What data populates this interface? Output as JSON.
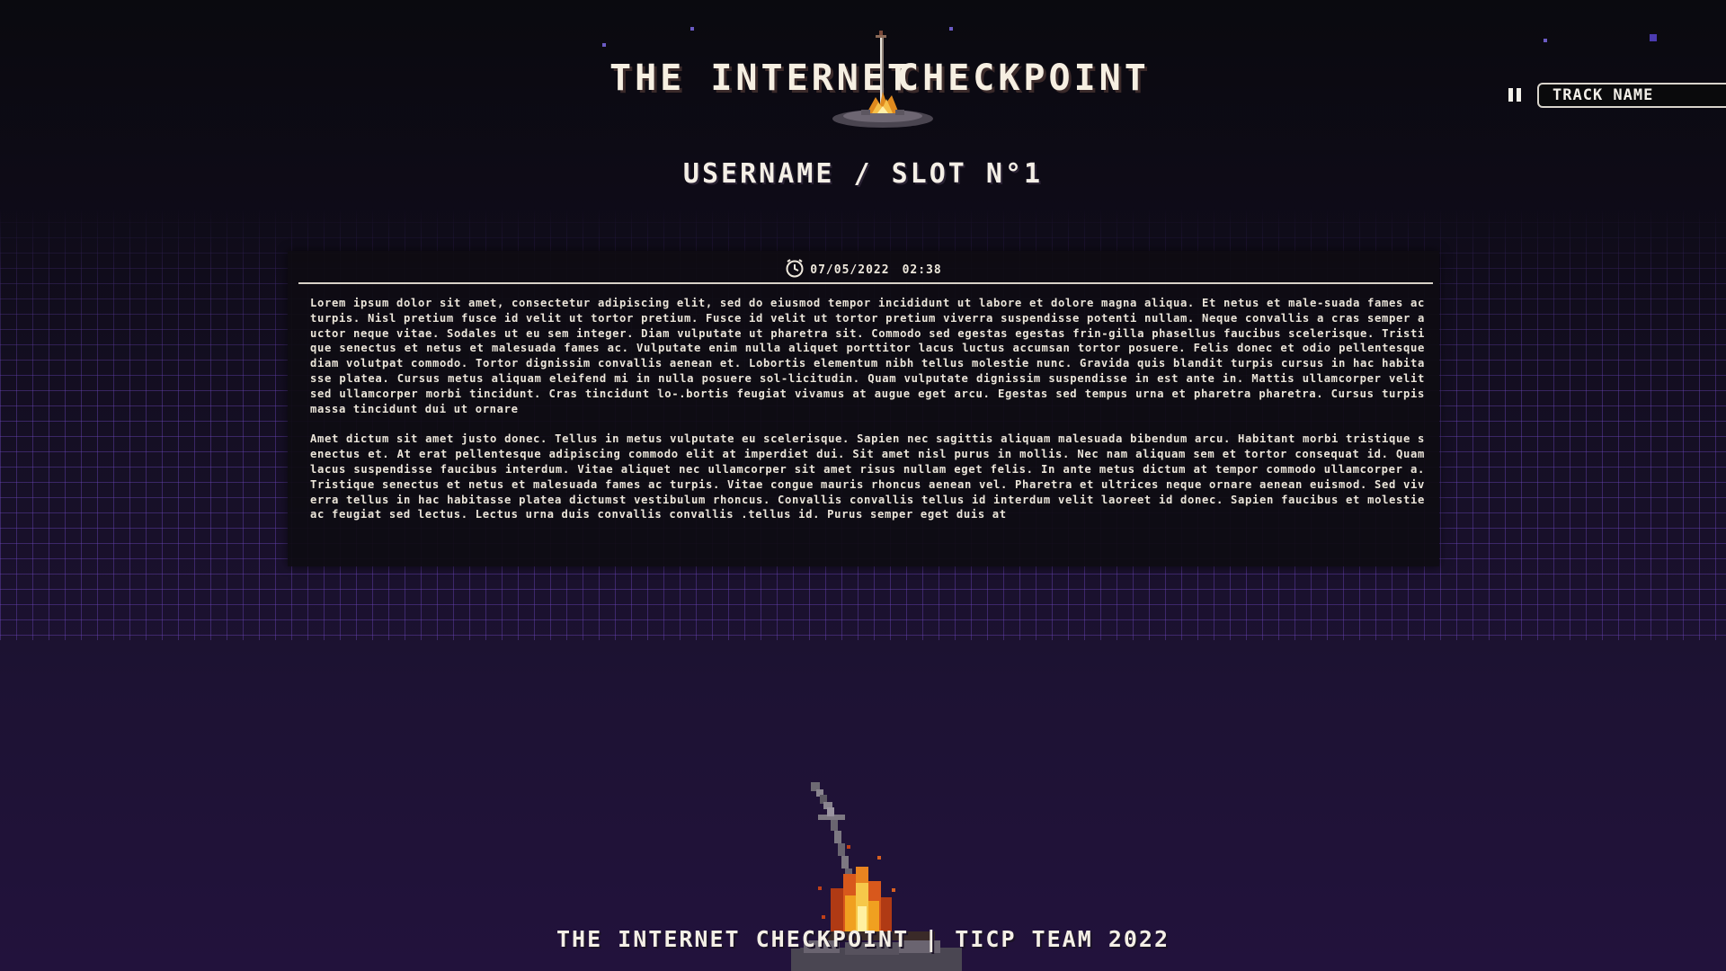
{
  "site": {
    "logo_left": "THE INTERNET",
    "logo_right": "CHECKPOINT"
  },
  "player": {
    "track_name": "TRACK NAME",
    "pause_icon": "pause-icon"
  },
  "slot": {
    "title": "USERNAME / SLOT N°1"
  },
  "entry": {
    "clock_icon": "clock-icon",
    "date": "07/05/2022",
    "time": "02:38",
    "paragraphs": [
      "Lorem ipsum dolor sit amet, consectetur adipiscing elit, sed do eiusmod tempor incididunt ut labore et dolore magna aliqua. Et netus et male-suada fames ac turpis. Nisl pretium fusce id velit ut tortor pretium. Fusce id velit ut tortor pretium viverra suspendisse potenti nullam. Neque convallis a cras semper auctor neque vitae. Sodales ut eu sem integer. Diam vulputate ut pharetra sit. Commodo sed egestas egestas frin-gilla phasellus faucibus scelerisque. Tristique senectus et netus et malesuada fames ac. Vulputate enim nulla aliquet porttitor lacus luctus accumsan tortor posuere. Felis donec et odio pellentesque diam volutpat commodo. Tortor dignissim convallis aenean et. Lobortis elementum nibh tellus molestie nunc. Gravida quis blandit turpis cursus in hac habitasse platea. Cursus metus aliquam eleifend mi in nulla posuere sol-licitudin. Quam vulputate dignissim suspendisse in est ante in. Mattis ullamcorper velit sed ullamcorper morbi tincidunt. Cras tincidunt lo-.bortis feugiat vivamus at augue eget arcu. Egestas sed tempus urna et pharetra pharetra. Cursus turpis massa tincidunt dui ut ornare",
      "Amet dictum sit amet justo donec. Tellus in metus vulputate eu scelerisque. Sapien nec sagittis aliquam malesuada bibendum arcu. Habitant morbi tristique senectus et. At erat pellentesque adipiscing commodo elit at imperdiet dui. Sit amet nisl purus in mollis. Nec nam aliquam sem et tortor consequat id. Quam lacus suspendisse faucibus interdum. Vitae aliquet nec ullamcorper sit amet risus nullam eget felis. In ante metus dictum at tempor commodo ullamcorper a. Tristique senectus et netus et malesuada fames ac turpis. Vitae congue mauris rhoncus aenean vel. Pharetra et ultrices neque ornare aenean euismod. Sed viverra tellus in hac habitasse platea dictumst vestibulum rhoncus. Convallis convallis tellus id interdum velit laoreet id donec. Sapien faucibus et molestie ac feugiat sed lectus. Lectus urna duis convallis convallis .tellus id. Purus semper eget duis at"
    ]
  },
  "footer": {
    "text": "THE INTERNET CHECKPOINT | TICP TEAM 2022",
    "bonfire_icon": "bonfire-icon"
  },
  "theme": {
    "background": "#0b0a12",
    "grid": "#6e48be",
    "text": "#f2eee6",
    "panel": "#0e0c12",
    "flame": "#f0a020"
  }
}
